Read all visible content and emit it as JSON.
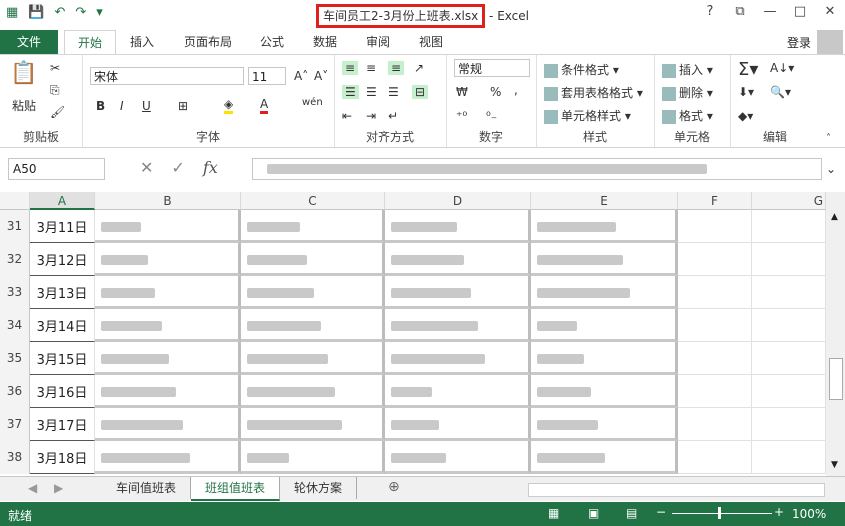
{
  "window": {
    "title_file": "车间员工2-3月份上班表.xlsx",
    "title_app": "- Excel",
    "help": "?",
    "restore": "⧉",
    "minimize": "—",
    "maximize": "□",
    "close": "✕"
  },
  "ribbon_tabs": [
    "文件",
    "开始",
    "插入",
    "页面布局",
    "公式",
    "数据",
    "审阅",
    "视图"
  ],
  "login": "登录",
  "ribbon": {
    "clipboard": {
      "label": "剪贴板",
      "paste": "粘贴"
    },
    "font": {
      "label": "字体",
      "name": "宋体",
      "size": "11",
      "bold": "B",
      "italic": "I",
      "underline": "U",
      "fontcolor": "A",
      "wen": "wén"
    },
    "align": {
      "label": "对齐方式"
    },
    "number": {
      "label": "数字",
      "format": "常规",
      "pct": "%",
      "comma": ","
    },
    "styles": {
      "label": "样式",
      "cond": "条件格式",
      "table": "套用表格格式",
      "cell": "单元格样式"
    },
    "cells": {
      "label": "单元格",
      "insert": "插入",
      "delete": "删除",
      "format": "格式"
    },
    "edit": {
      "label": "编辑"
    }
  },
  "formula": {
    "namebox": "A50",
    "fx": "fx"
  },
  "columns": [
    "A",
    "B",
    "C",
    "D",
    "E",
    "F",
    "G"
  ],
  "rows": [
    {
      "num": "31",
      "a": "3月11日"
    },
    {
      "num": "32",
      "a": "3月12日"
    },
    {
      "num": "33",
      "a": "3月13日"
    },
    {
      "num": "34",
      "a": "3月14日"
    },
    {
      "num": "35",
      "a": "3月15日"
    },
    {
      "num": "36",
      "a": "3月16日"
    },
    {
      "num": "37",
      "a": "3月17日"
    },
    {
      "num": "38",
      "a": "3月18日"
    }
  ],
  "sheets": [
    "车间值班表",
    "班组值班表",
    "轮休方案"
  ],
  "active_sheet": 1,
  "status": {
    "ready": "就绪",
    "zoom": "100%"
  },
  "colors": {
    "accent": "#217346",
    "highlight": "#e0201f"
  }
}
